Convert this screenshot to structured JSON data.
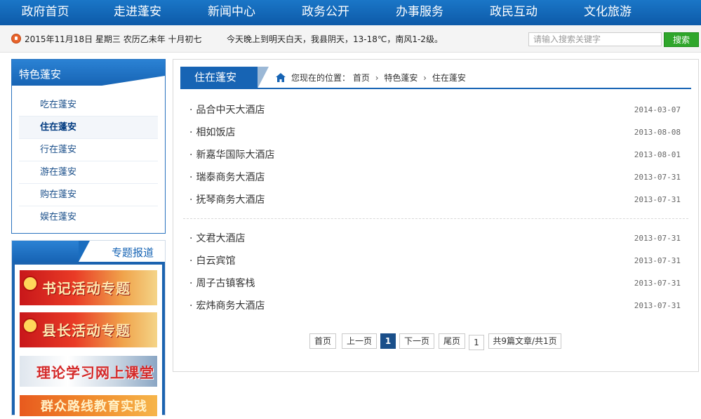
{
  "nav": [
    "政府首页",
    "走进蓬安",
    "新闻中心",
    "政务公开",
    "办事服务",
    "政民互动",
    "文化旅游"
  ],
  "infobar": {
    "date": "2015年11月18日  星期三  农历乙未年  十月初七",
    "weather": "今天晚上到明天白天，我县阴天，13-18℃，南风1-2级。",
    "search_placeholder": "请输入搜索关键字",
    "search_button": "搜索"
  },
  "sidebar": {
    "title": "特色蓬安",
    "items": [
      {
        "label": "吃在蓬安",
        "active": false
      },
      {
        "label": "住在蓬安",
        "active": true
      },
      {
        "label": "行在蓬安",
        "active": false
      },
      {
        "label": "游在蓬安",
        "active": false
      },
      {
        "label": "购在蓬安",
        "active": false
      },
      {
        "label": "娱在蓬安",
        "active": false
      }
    ]
  },
  "special": {
    "title": "专题报道",
    "banners": [
      "书记活动专题",
      "县长活动专题",
      "理论学习网上课堂",
      "群众路线教育实践活动"
    ]
  },
  "main": {
    "tab_title": "住在蓬安",
    "breadcrumb": {
      "prefix": "您现在的位置：",
      "items": [
        "首页",
        "特色蓬安",
        "住在蓬安"
      ]
    },
    "articles_group1": [
      {
        "title": "品合中天大酒店",
        "date": "2014-03-07"
      },
      {
        "title": "相如饭店",
        "date": "2013-08-08"
      },
      {
        "title": "新嘉华国际大酒店",
        "date": "2013-08-01"
      },
      {
        "title": "瑞泰商务大酒店",
        "date": "2013-07-31"
      },
      {
        "title": "抚琴商务大酒店",
        "date": "2013-07-31"
      }
    ],
    "articles_group2": [
      {
        "title": "文君大酒店",
        "date": "2013-07-31"
      },
      {
        "title": "白云宾馆",
        "date": "2013-07-31"
      },
      {
        "title": "周子古镇客栈",
        "date": "2013-07-31"
      },
      {
        "title": "宏炜商务大酒店",
        "date": "2013-07-31"
      }
    ],
    "pager": {
      "first": "首页",
      "prev": "上一页",
      "current": "1",
      "next": "下一页",
      "last": "尾页",
      "jump_value": "1",
      "summary": "共9篇文章/共1页"
    }
  }
}
